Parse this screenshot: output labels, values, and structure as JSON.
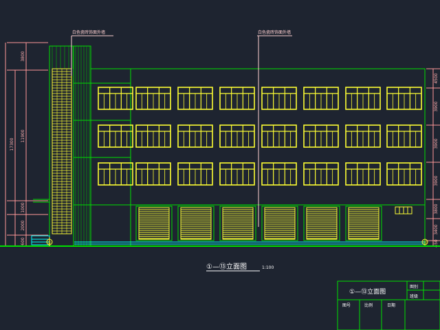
{
  "annotations": {
    "left": "白色瓷砖饰面外墙",
    "center": "白色瓷砖饰面外墙"
  },
  "dimensions_left": {
    "chain": [
      "3800",
      "11900",
      "1000",
      "2000",
      "600"
    ],
    "total_inner": "11900",
    "total": "17300"
  },
  "dimensions_right": [
    "4500",
    "3900",
    "3900",
    "3900",
    "3800",
    "3400",
    "450"
  ],
  "axis_left": "①",
  "axis_right": "⑬",
  "drawing_title": "①—⑬立面图",
  "scale": "1:100",
  "title_block": {
    "name": "①—⑬立面图",
    "cell_a": "图别",
    "cell_b": "班级",
    "footer": [
      "图号",
      "比例",
      "日期"
    ]
  },
  "colors": {
    "background": "#1e2430",
    "outline": "#00e000",
    "window": "#ffff33",
    "dimension": "#ff9999",
    "ground": "#00ffff",
    "annotation": "#ffd0d0"
  }
}
